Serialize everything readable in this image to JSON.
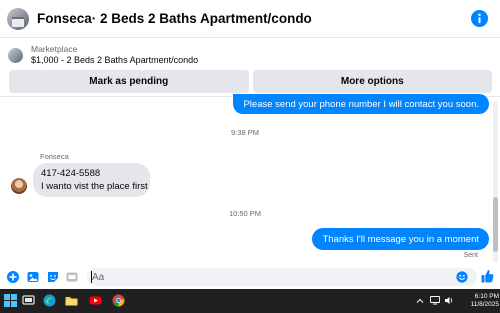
{
  "header": {
    "title": "Fonseca· 2 Beds 2 Baths Apartment/condo"
  },
  "marketplace": {
    "label": "Marketplace",
    "listing": "$1,000 - 2 Beds 2 Baths Apartment/condo"
  },
  "actions": {
    "mark_pending": "Mark as pending",
    "more_options": "More options"
  },
  "conversation": {
    "outgoing_1": "Please send your phone number I will contact you soon.",
    "timestamp_1": "9:38 PM",
    "sender_name": "Fonseca",
    "incoming_line_1": "417-424-5588",
    "incoming_line_2": "I wanto vist the place first",
    "timestamp_2": "10:50 PM",
    "outgoing_2": "Thanks I'll message you in a moment",
    "status": "Sent"
  },
  "composer": {
    "placeholder": "Aa"
  },
  "taskbar": {
    "time": "6:10 PM",
    "date": "11/8/2025"
  },
  "colors": {
    "accent": "#0084ff",
    "incoming_bubble": "#e4e6eb",
    "taskbar_bg": "#202020"
  },
  "icons": [
    "info-icon",
    "plus-icon",
    "image-icon",
    "sticker-icon",
    "gif-icon",
    "emoji-icon",
    "like-icon",
    "windows-icon",
    "search-icon",
    "task-view-icon",
    "edge-icon",
    "file-explorer-icon",
    "youtube-icon",
    "chrome-icon",
    "chevron-up-icon",
    "network-icon",
    "volume-icon"
  ]
}
